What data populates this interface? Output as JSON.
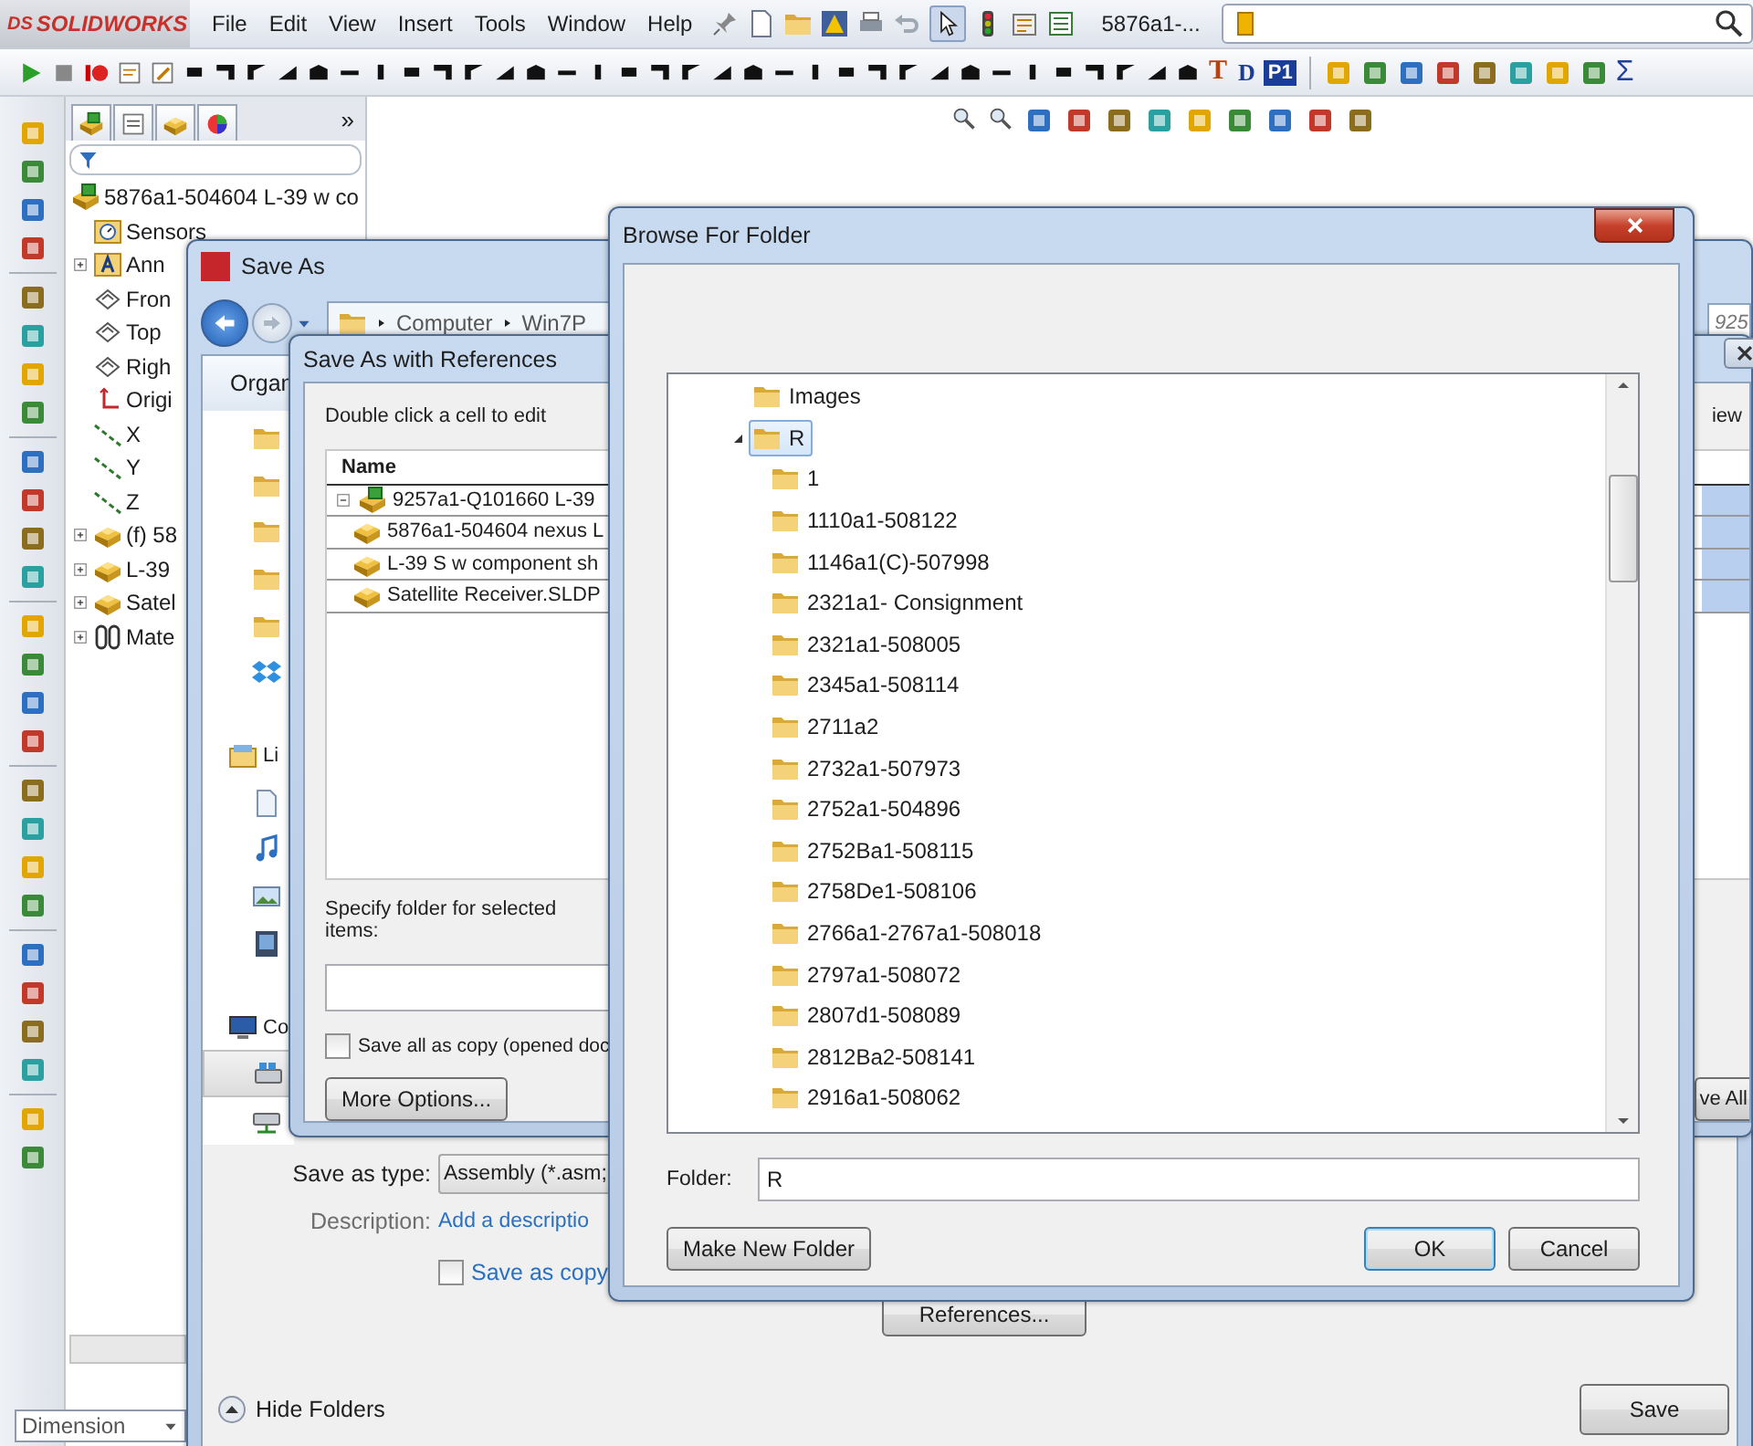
{
  "app": {
    "logo_mark": "DS",
    "logo_name": "SOLIDWORKS",
    "menu": [
      "File",
      "Edit",
      "View",
      "Insert",
      "Tools",
      "Window",
      "Help"
    ],
    "document_title": "5876a1-...",
    "command_letters": [
      "T",
      "D",
      "P1"
    ],
    "sum_symbol": "Σ"
  },
  "feature_tree": {
    "panel_more": "»",
    "root": {
      "label": "5876a1-504604 L-39 w co",
      "kind": "assembly",
      "children": [
        {
          "label": "Sensors",
          "kind": "sensors"
        },
        {
          "label": "Ann",
          "kind": "annotations",
          "expanded": false
        },
        {
          "label": "Fron",
          "kind": "plane"
        },
        {
          "label": "Top",
          "kind": "plane"
        },
        {
          "label": "Righ",
          "kind": "plane"
        },
        {
          "label": "Origi",
          "kind": "origin"
        },
        {
          "label": "X",
          "kind": "axis"
        },
        {
          "label": "Y",
          "kind": "axis"
        },
        {
          "label": "Z",
          "kind": "axis"
        },
        {
          "label": "(f) 58",
          "kind": "part",
          "expanded": false
        },
        {
          "label": "L-39",
          "kind": "part",
          "expanded": false
        },
        {
          "label": "Satel",
          "kind": "part",
          "expanded": false
        },
        {
          "label": "Mate",
          "kind": "mates",
          "expanded": false
        }
      ]
    },
    "dimension_select": "Dimension"
  },
  "save_as": {
    "title": "Save As",
    "breadcrumb": [
      "Computer",
      "Win7P"
    ],
    "search_text": "925",
    "organize": "Organ",
    "nav": [
      {
        "kind": "folder",
        "selected": false
      },
      {
        "kind": "folder",
        "selected": false
      },
      {
        "kind": "folder",
        "selected": false
      },
      {
        "kind": "folder",
        "selected": false
      },
      {
        "kind": "folder",
        "selected": false
      },
      {
        "kind": "dropbox",
        "selected": false
      },
      {
        "kind": "library",
        "label": "Li",
        "selected": false
      },
      {
        "kind": "document",
        "selected": false
      },
      {
        "kind": "music",
        "selected": false
      },
      {
        "kind": "picture",
        "selected": false
      },
      {
        "kind": "video",
        "selected": false
      },
      {
        "kind": "computer",
        "label": "Co",
        "selected": false
      },
      {
        "kind": "drive",
        "selected": true
      },
      {
        "kind": "network-drive",
        "selected": false
      }
    ],
    "type_label": "Save as type:",
    "type_value": "Assembly (*.asm;",
    "description_label": "Description:",
    "description_link": "Add a descriptio",
    "save_copy": {
      "label": "Save as copy",
      "checked": false
    },
    "references_button": "References...",
    "hide_folders": "Hide Folders",
    "save_button": "Save"
  },
  "references": {
    "title": "Save As with References",
    "hint": "Double click a cell to edit",
    "preview_fragment": "iew",
    "column": "Name",
    "rows": [
      {
        "label": "9257a1-Q101660 L-39",
        "kind": "assembly",
        "expanded": true,
        "selected": true,
        "children": [
          {
            "label": "5876a1-504604 nexus L",
            "kind": "part",
            "selected": true
          },
          {
            "label": "L-39 S w component sh",
            "kind": "part",
            "selected": true
          },
          {
            "label": "Satellite Receiver.SLDP",
            "kind": "part",
            "selected": true
          }
        ]
      }
    ],
    "folder_label": "Specify folder for selected items:",
    "save_all_copy": {
      "label": "Save all as copy (opened doc",
      "checked": false
    },
    "more_options": "More Options...",
    "save_all_fragment": "ve All"
  },
  "browse": {
    "title": "Browse For Folder",
    "tree": [
      {
        "label": "Images",
        "selected": false
      },
      {
        "label": "R",
        "selected": true,
        "expanded": true,
        "children": [
          {
            "label": "1",
            "selected": false
          },
          {
            "label": "1110a1-508122",
            "selected": false
          },
          {
            "label": "1146a1(C)-507998",
            "selected": false
          },
          {
            "label": "2321a1- Consignment",
            "selected": false
          },
          {
            "label": "2321a1-508005",
            "selected": false
          },
          {
            "label": "2345a1-508114",
            "selected": false
          },
          {
            "label": "2711a2",
            "selected": false
          },
          {
            "label": "2732a1-507973",
            "selected": false
          },
          {
            "label": "2752a1-504896",
            "selected": false
          },
          {
            "label": "2752Ba1-508115",
            "selected": false
          },
          {
            "label": "2758De1-508106",
            "selected": false
          },
          {
            "label": "2766a1-2767a1-508018",
            "selected": false
          },
          {
            "label": "2797a1-508072",
            "selected": false
          },
          {
            "label": "2807d1-508089",
            "selected": false
          },
          {
            "label": "2812Ba2-508141",
            "selected": false
          },
          {
            "label": "2916a1-508062",
            "selected": false
          }
        ]
      }
    ],
    "folder_label": "Folder:",
    "folder_value": "R",
    "make_new_folder": "Make New Folder",
    "ok": "OK",
    "cancel": "Cancel"
  }
}
